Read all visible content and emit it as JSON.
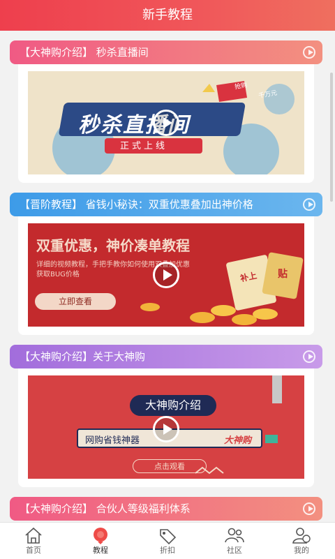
{
  "header": {
    "title": "新手教程"
  },
  "colors": {
    "header": "#ee3f4d",
    "ribbon1": "#f06b8a",
    "ribbon2": "#4aa3e8",
    "ribbon3": "#b07be0",
    "ribbon4": "#f06b8a"
  },
  "cards": [
    {
      "title": "【大神购介绍】 秒杀直播间",
      "thumb": {
        "main": "秒杀直播间",
        "sub": "正式上线",
        "badges": [
          "抢购",
          "千万元"
        ]
      }
    },
    {
      "title": "【晋阶教程】 省钱小秘诀：双重优惠叠加出神价格",
      "thumb": {
        "main": "双重优惠，神价凑单教程",
        "desc1": "详细的视频教程，手把手教你如何使用双叠加优惠",
        "desc2": "获取BUG价格",
        "button": "立即查看",
        "tag1": "补上",
        "tag2": "贴"
      }
    },
    {
      "title": "【大神购介绍】关于大神购",
      "thumb": {
        "main": "大神购介绍",
        "bar": "网购省钱神器",
        "brand": "大神购",
        "button": "点击观看"
      }
    },
    {
      "title": "【大神购介绍】 合伙人等级福利体系"
    }
  ],
  "tabbar": [
    {
      "label": "首页",
      "icon": "home-icon"
    },
    {
      "label": "教程",
      "icon": "tutorial-icon",
      "active": true
    },
    {
      "label": "折扣",
      "icon": "discount-tag-icon"
    },
    {
      "label": "社区",
      "icon": "community-icon"
    },
    {
      "label": "我的",
      "icon": "profile-icon"
    }
  ]
}
